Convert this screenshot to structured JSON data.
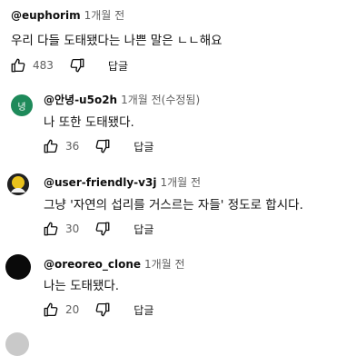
{
  "comments": [
    {
      "author": "@euphorim",
      "time": "1개월 전",
      "text": "우리 다들 도태됐다는 나쁜 말은 ㄴㄴ해요",
      "likes": "483",
      "reply": "답글"
    },
    {
      "author": "@안녕-u5o2h",
      "time": "1개월 전(수정됨)",
      "text": "나 또한 도태됐다.",
      "likes": "36",
      "reply": "답글",
      "avatar_letter": "녕",
      "avatar_color": "#1e8a5a"
    },
    {
      "author": "@user-friendly-v3j",
      "time": "1개월 전",
      "text": "그냥 '자연의 섭리를 거스르는 자들' 정도로 합시다.",
      "likes": "30",
      "reply": "답글"
    },
    {
      "author": "@oreoreo_clone",
      "time": "1개월 전",
      "text": "나는 도태됐다.",
      "likes": "20",
      "reply": "답글"
    }
  ],
  "icons": {
    "like": "thumb-up-icon",
    "dislike": "thumb-down-icon"
  }
}
